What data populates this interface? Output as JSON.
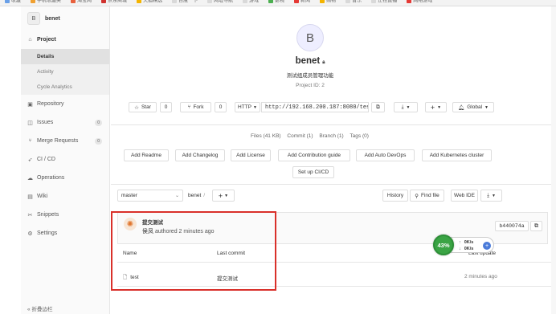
{
  "bookmarks": [
    {
      "label": "收藏",
      "color": "#6aa0e8"
    },
    {
      "label": "手机收藏夹",
      "color": "#f0a030"
    },
    {
      "label": "淘宝网",
      "color": "#e8603c"
    },
    {
      "label": "京东商城",
      "color": "#d0322e"
    },
    {
      "label": "天猫精选",
      "color": "#f4b400"
    },
    {
      "label": "百度一下",
      "color": "#d9d9d9"
    },
    {
      "label": "网址导航",
      "color": "#d9d9d9"
    },
    {
      "label": "游戏",
      "color": "#d9d9d9"
    },
    {
      "label": "影视",
      "color": "#4caf50"
    },
    {
      "label": "新闻",
      "color": "#e53935"
    },
    {
      "label": "购物",
      "color": "#f4b400"
    },
    {
      "label": "音乐",
      "color": "#d9d9d9"
    },
    {
      "label": "正在直播",
      "color": "#d9d9d9"
    },
    {
      "label": "网络游戏",
      "color": "#e53935"
    }
  ],
  "sidebar": {
    "avatar_letter": "B",
    "project_name": "benet",
    "project_label": "Project",
    "project_sub": [
      "Details",
      "Activity",
      "Cycle Analytics"
    ],
    "items": [
      {
        "label": "Repository",
        "icon": "repository-icon",
        "glyph": "▣"
      },
      {
        "label": "Issues",
        "icon": "issues-icon",
        "glyph": "◫",
        "count": "0"
      },
      {
        "label": "Merge Requests",
        "icon": "merge-request-icon",
        "glyph": "⑂",
        "count": "0"
      },
      {
        "label": "CI / CD",
        "icon": "rocket-icon",
        "glyph": "➶"
      },
      {
        "label": "Operations",
        "icon": "cloud-icon",
        "glyph": "☁"
      },
      {
        "label": "Wiki",
        "icon": "book-icon",
        "glyph": "▤"
      },
      {
        "label": "Snippets",
        "icon": "scissors-icon",
        "glyph": "✂"
      },
      {
        "label": "Settings",
        "icon": "gear-icon",
        "glyph": "⚙"
      }
    ],
    "collapse_label": "折叠边栏"
  },
  "project": {
    "avatar_letter": "B",
    "name": "benet",
    "description": "测试组成员管理功能",
    "project_id": "Project ID: 2"
  },
  "actions": {
    "star_label": "Star",
    "star_count": "0",
    "fork_label": "Fork",
    "fork_count": "0",
    "protocol": "HTTP",
    "clone_url": "http://192.168.200.187:8080/test/benet.git",
    "notification": "Global"
  },
  "stats": {
    "files": "Files (41 KB)",
    "commit": "Commit (1)",
    "branch": "Branch (1)",
    "tags": "Tags (0)"
  },
  "quick_buttons": [
    "Add Readme",
    "Add Changelog",
    "Add License",
    "Add Contribution guide",
    "Add Auto DevOps",
    "Add Kubernetes cluster",
    "Set up CI/CD"
  ],
  "repo": {
    "branch": "master",
    "path": "benet",
    "history_label": "History",
    "find_file_label": "Find file",
    "web_ide_label": "Web IDE"
  },
  "commit": {
    "title": "提交测试",
    "author": "侯凤",
    "authored": "authored 2 minutes ago",
    "sha": "b440074a"
  },
  "files_table": {
    "headers": {
      "name": "Name",
      "last_commit": "Last commit",
      "last_update": "Last update"
    },
    "rows": [
      {
        "name": "test",
        "last_commit": "提交测试",
        "last_update": "2 minutes ago"
      }
    ]
  },
  "speed_widget": {
    "percent": "43%",
    "up": "0K/s",
    "down": "0K/s",
    "color": "#3aa444"
  }
}
